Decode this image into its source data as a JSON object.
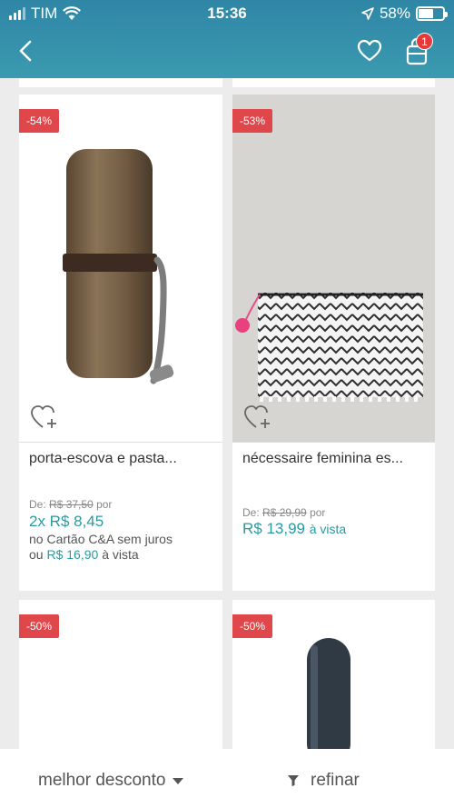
{
  "status_bar": {
    "carrier": "TIM",
    "time": "15:36",
    "battery": "58%",
    "battery_level": 0.58
  },
  "header": {
    "cart_count": "1",
    "icons": [
      "back-arrow-icon",
      "heart-icon",
      "shopping-bag-icon"
    ]
  },
  "products": [
    {
      "discount": "-54%",
      "name": "porta-escova e pasta...",
      "from_label": "De:",
      "old_price": "R$ 37,50",
      "por": "por",
      "installments": "2x R$ 8,45",
      "installments_note": "no Cartão C&A sem juros",
      "cash_prefix": "ou",
      "cash_price": "R$ 16,90",
      "cash_suffix": "à vista"
    },
    {
      "discount": "-53%",
      "name": "nécessaire feminina es...",
      "from_label": "De:",
      "old_price": "R$ 29,99",
      "por": "por",
      "price": "R$ 13,99",
      "price_suffix": "à vista"
    },
    {
      "discount": "-50%"
    },
    {
      "discount": "-50%"
    }
  ],
  "bottom_bar": {
    "sort_label": "melhor desconto",
    "refine_label": "refinar"
  },
  "colors": {
    "header": "#3794ad",
    "badge": "#e0474a",
    "accent": "#2b9aa0"
  }
}
